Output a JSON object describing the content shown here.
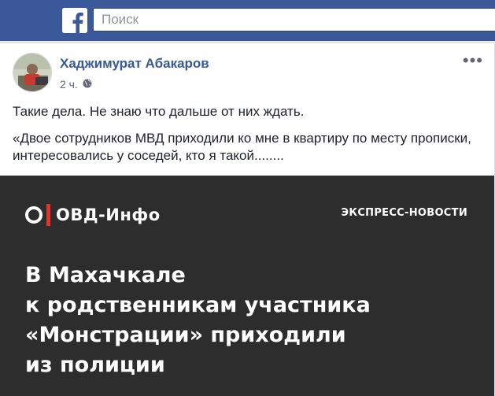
{
  "topbar": {
    "logo_icon": "facebook-f-icon",
    "search_placeholder": "Поиск",
    "brand_color": "#3b5998"
  },
  "post": {
    "author": "Хаджимурат Абакаров",
    "time": "2 ч.",
    "privacy_icon": "globe-icon",
    "more_icon": "ellipsis-icon",
    "text_line1": "Такие дела. Не знаю что дальше от них ждать.",
    "quote": "«Двое сотрудников МВД приходили ко мне в квартиру по месту прописки, интересовались у соседей, кто я такой........"
  },
  "news_image": {
    "logo_text": "ОВД-Инфо",
    "tag": "ЭКСПРЕСС-НОВОСТИ",
    "headline_lines": [
      "В Махачкале",
      "к родственникам участника",
      "«Монстрации» приходили",
      "из полиции"
    ],
    "background_color": "#2d2d2d",
    "accent_color": "#e63229"
  }
}
